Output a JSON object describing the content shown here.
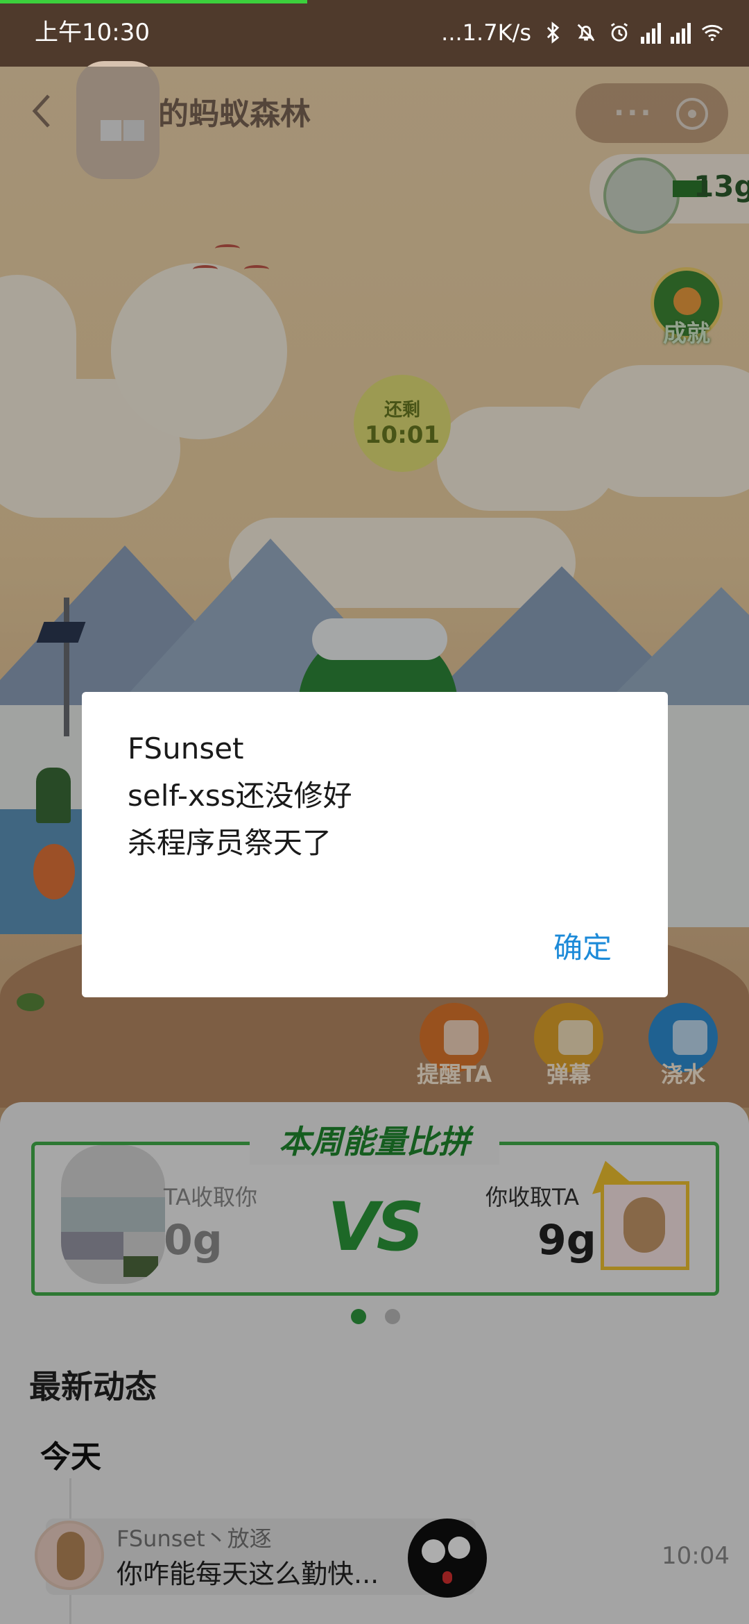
{
  "status_bar": {
    "time": "上午10:30",
    "net_speed": "...1.7K/s",
    "icons": [
      "bluetooth-icon",
      "mute-icon",
      "alarm-icon",
      "hd-signal-icon",
      "hd-signal-icon",
      "wifi-icon"
    ]
  },
  "header": {
    "title": "的蚂蚁森林",
    "more_label": "···"
  },
  "game": {
    "energy_amount": "13g",
    "achievement_label": "成就",
    "timer_label": "还剩",
    "timer_value": "10:01",
    "actions": [
      {
        "label": "提醒TA",
        "icon": "bell-icon",
        "color": "#e0782d"
      },
      {
        "label": "弹幕",
        "icon": "chat-icon",
        "color": "#e3a52b"
      },
      {
        "label": "浇水",
        "icon": "watering-can-icon",
        "color": "#2f8fd6"
      }
    ]
  },
  "compete": {
    "title": "本周能量比拼",
    "ta_label": "TA收取你",
    "ta_value": "0g",
    "vs": "VS",
    "you_label": "你收取TA",
    "you_value": "9g",
    "page_dots": 2,
    "active_dot": 0
  },
  "feed": {
    "heading": "最新动态",
    "day": "今天",
    "items": [
      {
        "name": "FSunset丶放逐",
        "text": "你咋能每天这么勤快...",
        "time": "10:04"
      }
    ]
  },
  "dialog": {
    "lines": [
      "FSunset",
      "self-xss还没修好",
      "杀程序员祭天了"
    ],
    "ok_label": "确定"
  },
  "colors": {
    "accent_green": "#2b9a3a",
    "dialog_button": "#1c8ad8"
  }
}
